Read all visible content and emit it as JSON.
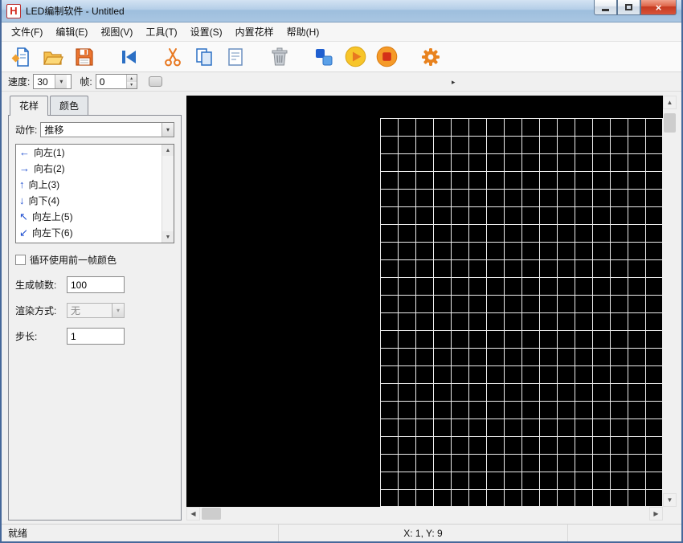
{
  "window": {
    "title": "LED编制软件 - Untitled",
    "icon_letter": "H",
    "controls": {
      "close": "×"
    }
  },
  "icons": {
    "dropdown": "▾",
    "spin_up": "▴",
    "spin_down": "▾",
    "scroll_up": "▲",
    "scroll_down": "▼",
    "scroll_left": "◀",
    "scroll_right": "▶",
    "track_arrow": "▸"
  },
  "menu": {
    "items": [
      {
        "label": "文件(F)"
      },
      {
        "label": "编辑(E)"
      },
      {
        "label": "视图(V)"
      },
      {
        "label": "工具(T)"
      },
      {
        "label": "设置(S)"
      },
      {
        "label": "内置花样"
      },
      {
        "label": "帮助(H)"
      }
    ]
  },
  "toolbar": {
    "buttons": [
      {
        "name": "new-file"
      },
      {
        "name": "open-file"
      },
      {
        "name": "save-file"
      },
      {
        "name": "rewind"
      },
      {
        "name": "cut"
      },
      {
        "name": "copy"
      },
      {
        "name": "paste"
      },
      {
        "name": "delete"
      },
      {
        "name": "pattern"
      },
      {
        "name": "play"
      },
      {
        "name": "stop"
      },
      {
        "name": "settings"
      }
    ]
  },
  "speedbar": {
    "speed_label": "速度:",
    "speed_value": "30",
    "frame_label": "帧:",
    "frame_value": "0"
  },
  "panel": {
    "tabs": [
      {
        "label": "花样",
        "active": true
      },
      {
        "label": "颜色",
        "active": false
      }
    ],
    "action_label": "动作:",
    "action_value": "推移",
    "list_items": [
      {
        "arrow": "←",
        "label": "向左(1)"
      },
      {
        "arrow": "→",
        "label": "向右(2)"
      },
      {
        "arrow": "↑",
        "label": "向上(3)"
      },
      {
        "arrow": "↓",
        "label": "向下(4)"
      },
      {
        "arrow": "↖",
        "label": "向左上(5)"
      },
      {
        "arrow": "↙",
        "label": "向左下(6)"
      }
    ],
    "checkbox_label": "循环使用前一帧颜色",
    "checkbox_checked": false,
    "frames_label": "生成帧数:",
    "frames_value": "100",
    "render_label": "渲染方式:",
    "render_value": "无",
    "step_label": "步长:",
    "step_value": "1"
  },
  "canvas": {
    "background": "#000000",
    "grid": {
      "cols": 16,
      "rows": 22,
      "cell": 22,
      "line_color": "#ededed"
    }
  },
  "statusbar": {
    "ready": "就绪",
    "coords": "X: 1, Y: 9"
  }
}
